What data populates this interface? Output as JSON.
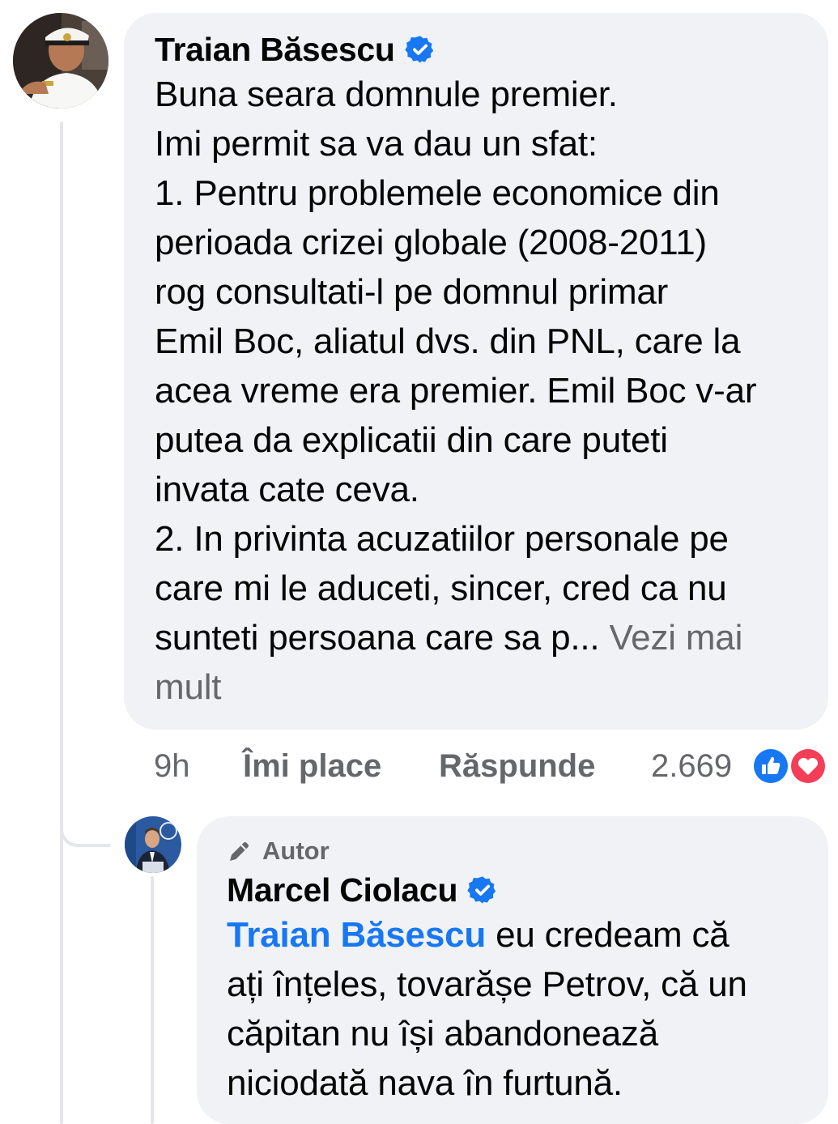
{
  "comment": {
    "author_name": "Traian Băsescu",
    "lines": [
      "Buna seara domnule premier.",
      "Imi permit sa va dau un sfat:",
      "1. Pentru problemele economice din",
      "perioada crizei globale (2008-2011)",
      "rog consultati-l pe domnul primar",
      "Emil Boc, aliatul dvs. din PNL, care la",
      "acea vreme era premier. Emil Boc v-ar",
      "putea da explicatii din care puteti",
      "invata cate ceva.",
      "2. In privinta acuzatiilor personale pe",
      "care mi le aduceti, sincer, cred ca nu"
    ],
    "last_line": "sunteti persoana care sa p... ",
    "see_more_part1": "Vezi mai",
    "see_more_part2": "mult",
    "time": "9h",
    "like_label": "Îmi place",
    "reply_label": "Răspunde",
    "reaction_count": "2.669",
    "reactions": [
      "like-icon",
      "love-icon"
    ]
  },
  "reply": {
    "badge_label": "Autor",
    "author_name": "Marcel Ciolacu",
    "mention": "Traian Băsescu",
    "first_line_rest": " eu credeam că",
    "lines": [
      "ați înțeles, tovarășe Petrov, că un",
      "căpitan nu își abandonează",
      "niciodată nava în furtună."
    ]
  },
  "colors": {
    "bubble": "#f0f2f5",
    "text": "#050505",
    "secondary": "#65676b",
    "accent": "#1877f2",
    "love": "#f33e58"
  }
}
